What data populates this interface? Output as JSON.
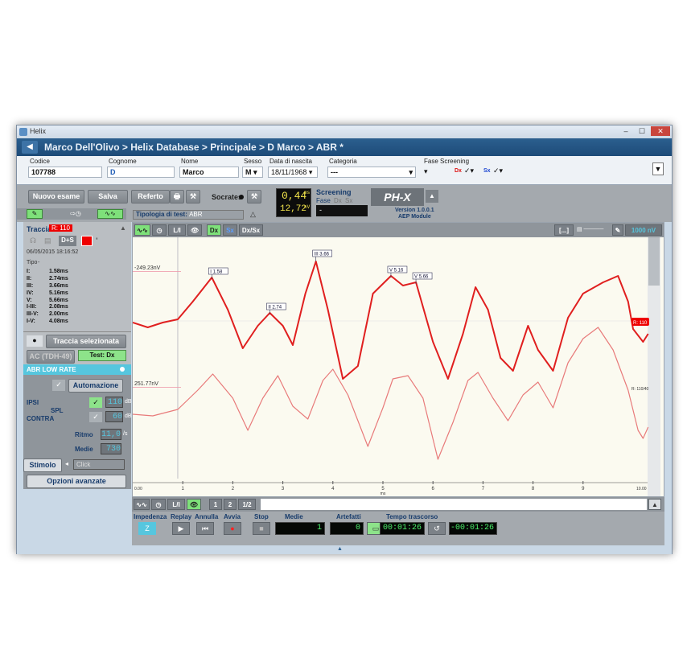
{
  "window": {
    "title": "Helix",
    "min": "–",
    "max": "☐",
    "close": "✕"
  },
  "breadcrumb": "Marco Dell'Olivo > Helix Database > Principale > D Marco > ABR *",
  "patient": {
    "codice_label": "Codice",
    "codice": "107788",
    "cognome_label": "Cognome",
    "cognome": "D",
    "nome_label": "Nome",
    "nome": "Marco",
    "sesso_label": "Sesso",
    "sesso": "M",
    "nascita_label": "Data di nascita",
    "nascita": "18/11/1968",
    "categoria_label": "Categoria",
    "categoria": "---",
    "fase_label": "Fase Screening",
    "dx": "Dx",
    "sx": "Sx"
  },
  "toolbar": {
    "nuovo": "Nuovo esame",
    "salva": "Salva",
    "referto": "Referto",
    "socrates": "Socrates",
    "lcd_ms": "0,44",
    "lcd_ms_unit": "ms",
    "lcd_nv": "12,72",
    "lcd_nv_unit": "nV",
    "screening": "Screening",
    "fase": "Fase",
    "fase_dx": "Dx",
    "fase_sx": "Sx",
    "screening_value": "-",
    "tipologia_label": "Tipologia di test:",
    "tipologia_value": "ABR",
    "brand": "PH-X",
    "version": "Version 1.0.0.1",
    "module": "AEP Module"
  },
  "left": {
    "traccia": "Traccia",
    "traccia_badge": "R: 110",
    "ds": "D+S",
    "date": "06/05/2015 18:16:52",
    "tipo": "Tipo",
    "tipo_value": "-",
    "peaks": [
      {
        "k": "I:",
        "v": "1.58ms"
      },
      {
        "k": "II:",
        "v": "2.74ms"
      },
      {
        "k": "III:",
        "v": "3.66ms"
      },
      {
        "k": "IV:",
        "v": "5.16ms"
      },
      {
        "k": "V:",
        "v": "5.66ms"
      }
    ],
    "intervals": [
      {
        "k": "I-III:",
        "v": "2.08ms"
      },
      {
        "k": "III-V:",
        "v": "2.00ms"
      },
      {
        "k": "I-V:",
        "v": "4.08ms"
      }
    ],
    "traccia_sel": "Traccia selezionata",
    "ac": "AC (TDH-49)",
    "test_dx": "Test: Dx",
    "abr_low": "ABR LOW RATE",
    "automazione": "Automazione",
    "ipsi": "IPSI",
    "contra": "CONTRA",
    "spl": "SPL",
    "ipsi_val": "110",
    "contra_val": "60",
    "db": "dB",
    "ritmo_label": "Ritmo",
    "ritmo_val": "11,0",
    "ritmo_unit": "/s",
    "medie_label": "Medie",
    "medie_val": "730",
    "stimolo": "Stimolo",
    "click": "Click",
    "opzioni": "Opzioni avanzate"
  },
  "plot_toolbar": {
    "li": "L/I",
    "dx": "Dx",
    "sx": "Sx",
    "dxsx": "Dx/Sx",
    "dots": "[...]",
    "scale": "1000 nV"
  },
  "plot": {
    "top_label": "-249.23nV",
    "mid_label": "251.77nV",
    "badge_top": "R: 110",
    "badge_bottom": "R: 110/40",
    "peak_labels": [
      {
        "t": 1.58,
        "label": "I 1.58"
      },
      {
        "t": 2.74,
        "label": "II 2.74"
      },
      {
        "t": 3.66,
        "label": "III 3.66"
      },
      {
        "t": 5.16,
        "label": "V 5.16"
      },
      {
        "t": 5.66,
        "label": "V 5.66"
      }
    ],
    "x_ticks": [
      "1",
      "2",
      "3",
      "4",
      "5",
      "6",
      "7",
      "8",
      "9"
    ],
    "x_start": "0.00",
    "x_end": "10.00",
    "x_unit": "ms"
  },
  "bottom_tb": {
    "li": "L/I",
    "one": "1",
    "two": "2",
    "half": "1/2"
  },
  "controls": {
    "impedenza": "Impedenza",
    "replay": "Replay",
    "annulla": "Annulla",
    "avvia": "Avvia",
    "stop": "Stop",
    "medie": "Medie",
    "medie_val": "1",
    "artefatti": "Artefatti",
    "artefatti_val": "0",
    "tempo": "Tempo trascorso",
    "tempo_val": "00:01:26",
    "tempo_val2": "-00:01:26",
    "imp_val": "Z"
  },
  "colors": {
    "trace_main": "#e01f1f",
    "trace_sub": "#e87a7a",
    "lcd_yellow": "#f2e44b",
    "lcd_green": "#4df06c"
  }
}
